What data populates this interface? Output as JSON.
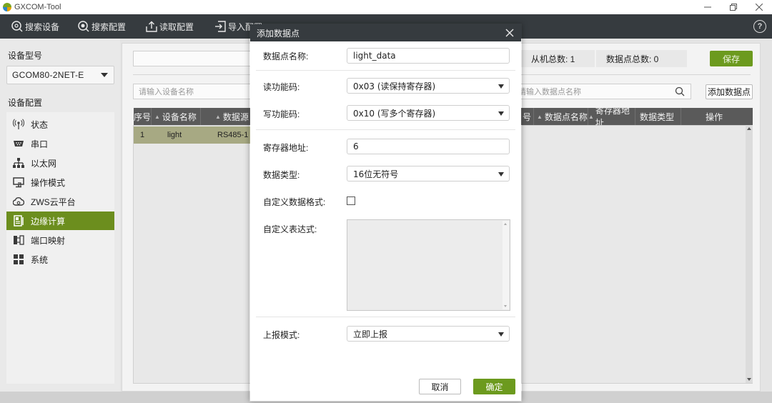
{
  "app": {
    "title": "GXCOM-Tool"
  },
  "window_controls": [
    "minimize",
    "restore",
    "close"
  ],
  "toolbar": {
    "items": [
      {
        "label": "搜索设备",
        "icon": "search-device-icon"
      },
      {
        "label": "搜索配置",
        "icon": "search-config-icon"
      },
      {
        "label": "读取配置",
        "icon": "read-config-icon"
      },
      {
        "label": "导入配置",
        "icon": "import-config-icon"
      }
    ]
  },
  "sidebar": {
    "device_model_heading": "设备型号",
    "device_model_value": "GCOM80-2NET-E",
    "device_config_heading": "设备配置",
    "items": [
      {
        "label": "状态",
        "icon": "signal-tower-icon"
      },
      {
        "label": "串口",
        "icon": "serial-port-icon"
      },
      {
        "label": "以太网",
        "icon": "network-icon"
      },
      {
        "label": "操作模式",
        "icon": "monitor-icon"
      },
      {
        "label": "ZWS云平台",
        "icon": "cloud-icon"
      },
      {
        "label": "边缘计算",
        "icon": "edge-computing-icon",
        "active": true
      },
      {
        "label": "端口映射",
        "icon": "port-mapping-icon"
      },
      {
        "label": "系统",
        "icon": "grid-icon"
      }
    ]
  },
  "main": {
    "slave_total": "从机总数: 1",
    "datapoint_total": "数据点总数: 0",
    "save_label": "保存",
    "device_search_placeholder": "请输入设备名称",
    "datapoint_search_placeholder": "请输入数据点名称",
    "add_datapoint_label": "添加数据点",
    "device_table": {
      "columns": [
        "序号",
        "设备名称",
        "数据源"
      ],
      "rows": [
        {
          "index": "1",
          "name": "light",
          "source": "RS485-1"
        }
      ]
    },
    "datapoint_table": {
      "columns": [
        "号",
        "数据点名称",
        "寄存器地址",
        "数据类型",
        "操作"
      ]
    }
  },
  "modal": {
    "title": "添加数据点",
    "fields": {
      "name_label": "数据点名称:",
      "name_value": "light_data",
      "read_fn_label": "读功能码:",
      "read_fn_value": "0x03 (读保持寄存器)",
      "write_fn_label": "写功能码:",
      "write_fn_value": "0x10 (写多个寄存器)",
      "register_label": "寄存器地址:",
      "register_value": "6",
      "datatype_label": "数据类型:",
      "datatype_value": "16位无符号",
      "custom_format_label": "自定义数据格式:",
      "custom_format_checked": false,
      "expression_label": "自定义表达式:",
      "expression_value": "",
      "report_mode_label": "上报模式:",
      "report_mode_value": "立即上报"
    },
    "cancel_label": "取消",
    "ok_label": "确定"
  },
  "colors": {
    "accent_green": "#6c9a1e",
    "active_nav": "#6c8e1e",
    "toolbar_dark": "#363b3f"
  }
}
